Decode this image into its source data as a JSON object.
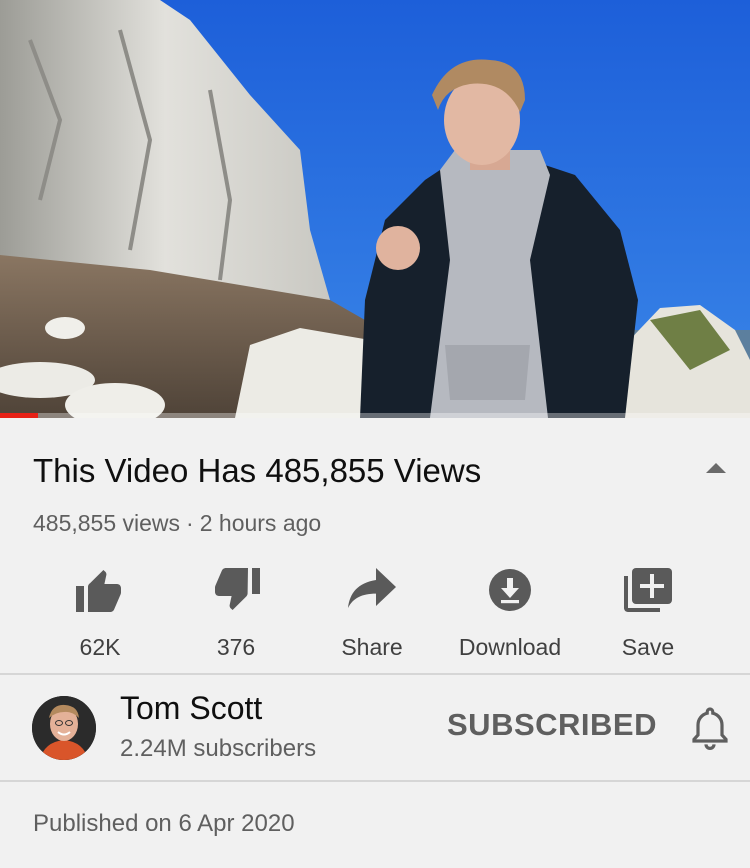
{
  "video": {
    "progress_fraction": 0.05,
    "progress_color": "#e62117"
  },
  "details": {
    "title": "This Video Has 485,855 Views",
    "views": "485,855 views",
    "separator": "·",
    "time_ago": "2 hours ago",
    "collapse_icon": "chevron-up-icon"
  },
  "actions": [
    {
      "label": "62K",
      "icon": "thumbs-up-icon"
    },
    {
      "label": "376",
      "icon": "thumbs-down-icon"
    },
    {
      "label": "Share",
      "icon": "share-icon"
    },
    {
      "label": "Download",
      "icon": "download-icon"
    },
    {
      "label": "Save",
      "icon": "add-to-playlist-icon"
    }
  ],
  "channel": {
    "name": "Tom Scott",
    "subscribers": "2.24M subscribers",
    "subscribe_label": "SUBSCRIBED",
    "bell_icon": "bell-icon"
  },
  "description": {
    "published": "Published on 6 Apr 2020"
  }
}
